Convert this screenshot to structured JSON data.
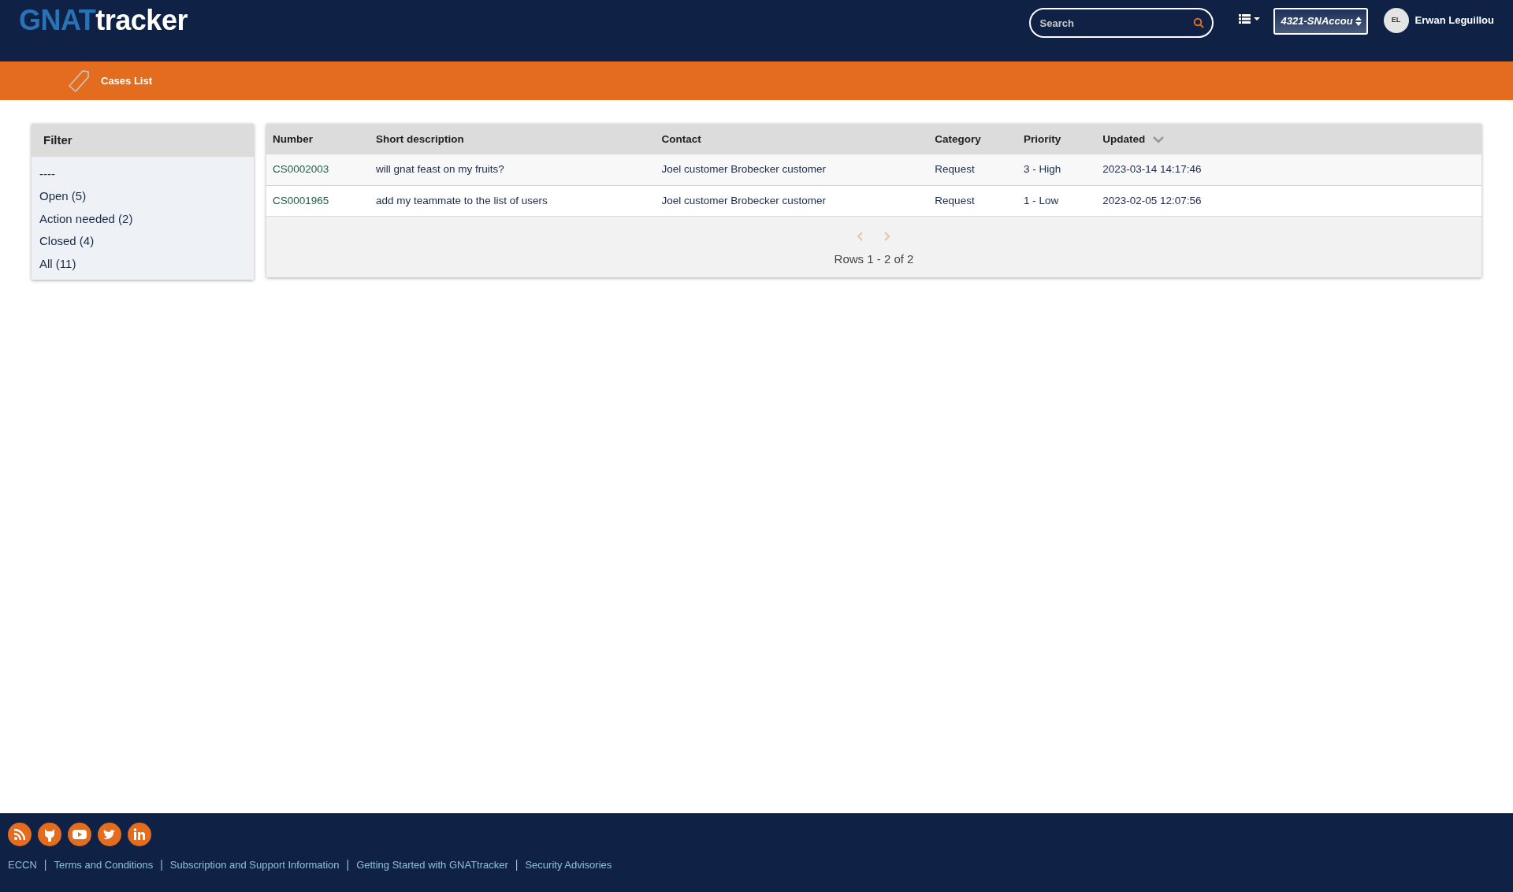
{
  "header": {
    "logo": [
      "GNAT",
      "tracker"
    ],
    "search": {
      "placeholder": "Search"
    },
    "account": "4321-SNAccou",
    "user": {
      "initials": "EL",
      "name": "Erwan Leguillou"
    }
  },
  "breadcrumb": {
    "title": "Cases List"
  },
  "filter": {
    "title": "Filter",
    "items": [
      {
        "label": "----"
      },
      {
        "label": "Open (5)"
      },
      {
        "label": "Action needed (2)"
      },
      {
        "label": "Closed (4)"
      },
      {
        "label": "All (11)"
      }
    ]
  },
  "table": {
    "columns": [
      {
        "label": "Number"
      },
      {
        "label": "Short description"
      },
      {
        "label": "Contact"
      },
      {
        "label": "Category"
      },
      {
        "label": "Priority"
      },
      {
        "label": "Updated",
        "sorted_descending": true
      }
    ],
    "rows": [
      [
        "CS0002003",
        "will gnat feast on my fruits?",
        "Joel customer Brobecker customer",
        "Request",
        "3 - High",
        "2023-03-14 14:17:46"
      ],
      [
        "CS0001965",
        "add my teammate to the list of users",
        "Joel customer Brobecker customer",
        "Request",
        "1 - Low",
        "2023-02-05 12:07:56"
      ]
    ],
    "pager": {
      "prev_disabled": true,
      "next_disabled": true,
      "summary": "Rows 1 - 2 of 2"
    }
  },
  "footer": {
    "items": [
      {
        "kind": "link",
        "label": "ECCN"
      },
      {
        "kind": "separator",
        "label": "|"
      },
      {
        "kind": "link",
        "label": "Terms and Conditions"
      },
      {
        "kind": "separator",
        "label": "|"
      },
      {
        "kind": "link",
        "label": "Subscription and Support Information"
      },
      {
        "kind": "separator",
        "label": "|"
      },
      {
        "kind": "link",
        "label": "Getting Started with GNATtracker"
      },
      {
        "kind": "separator",
        "label": "|"
      },
      {
        "kind": "link",
        "label": "Security Advisories"
      }
    ]
  }
}
